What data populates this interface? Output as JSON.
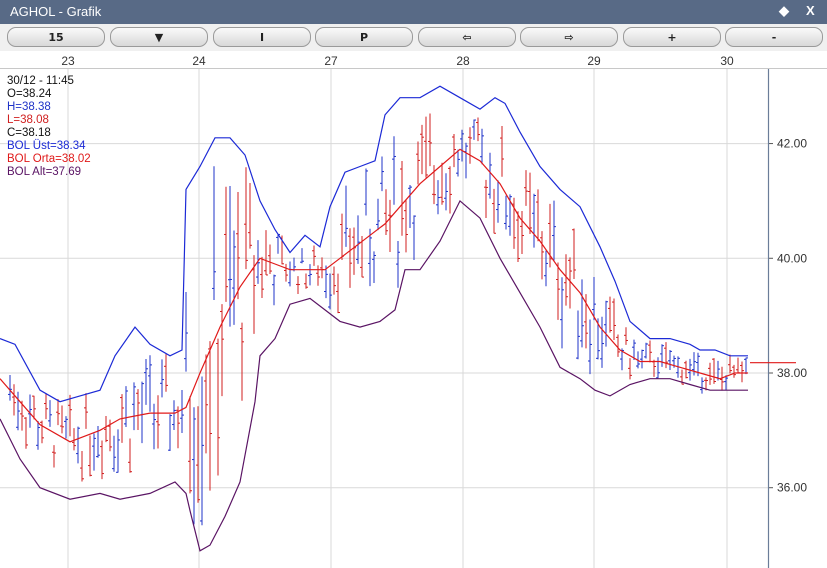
{
  "window": {
    "title": "AGHOL - Grafik",
    "pin_icon": "◆",
    "close_icon": "X"
  },
  "toolbar": {
    "buttons": [
      {
        "label": "15",
        "name": "interval-button"
      },
      {
        "label": "▼",
        "name": "chart-type-dropdown-button"
      },
      {
        "label": "I",
        "name": "indicator-button"
      },
      {
        "label": "P",
        "name": "period-button"
      },
      {
        "label": "⇦",
        "name": "scroll-left-button"
      },
      {
        "label": "⇨",
        "name": "scroll-right-button"
      },
      {
        "label": "+",
        "name": "zoom-in-button"
      },
      {
        "label": "-",
        "name": "zoom-out-button"
      }
    ]
  },
  "legend": {
    "datetime": "30/12 - 11:45",
    "open": "O=38.24",
    "high": "H=38.38",
    "low": "L=38.08",
    "close": "C=38.18",
    "bol_upper": "BOL Üst=38.34",
    "bol_middle": "BOL Orta=38.02",
    "bol_lower": "BOL Alt=37.69"
  },
  "colors": {
    "up_bar": "#1f33c8",
    "down_bar": "#d01f1f",
    "bol_upper": "#1c2ad6",
    "bol_middle": "#e01a1a",
    "bol_lower": "#5a1464",
    "grid": "#d9d9d9",
    "axis": "#6b7d99"
  },
  "chart_data": {
    "type": "ohlc",
    "x_labels": [
      "23",
      "24",
      "27",
      "28",
      "29",
      "30"
    ],
    "y_ticks": [
      "36.00",
      "38.00",
      "40.00",
      "42.00"
    ],
    "ylim": [
      34.6,
      43.3
    ],
    "last_price_marker": 38.18,
    "grid": true,
    "series": [
      {
        "name": "BOL Üst",
        "role": "bol_upper",
        "values": [
          [
            0,
            38.6
          ],
          [
            15,
            38.5
          ],
          [
            40,
            37.7
          ],
          [
            60,
            37.5
          ],
          [
            80,
            37.6
          ],
          [
            100,
            37.7
          ],
          [
            115,
            38.3
          ],
          [
            135,
            38.8
          ],
          [
            150,
            38.5
          ],
          [
            170,
            38.3
          ],
          [
            182,
            38.4
          ],
          [
            186,
            41.2
          ],
          [
            200,
            41.6
          ],
          [
            215,
            42.1
          ],
          [
            230,
            42.1
          ],
          [
            245,
            41.8
          ],
          [
            260,
            41.0
          ],
          [
            275,
            40.5
          ],
          [
            290,
            40.1
          ],
          [
            305,
            40.4
          ],
          [
            320,
            40.2
          ],
          [
            330,
            40.9
          ],
          [
            345,
            41.5
          ],
          [
            360,
            41.6
          ],
          [
            375,
            41.7
          ],
          [
            385,
            42.5
          ],
          [
            400,
            42.8
          ],
          [
            420,
            42.8
          ],
          [
            440,
            43.0
          ],
          [
            460,
            42.8
          ],
          [
            480,
            42.6
          ],
          [
            495,
            42.8
          ],
          [
            505,
            42.7
          ],
          [
            520,
            42.2
          ],
          [
            540,
            41.6
          ],
          [
            560,
            41.2
          ],
          [
            580,
            40.9
          ],
          [
            600,
            40.2
          ],
          [
            615,
            39.6
          ],
          [
            630,
            38.9
          ],
          [
            650,
            38.6
          ],
          [
            670,
            38.6
          ],
          [
            690,
            38.5
          ],
          [
            700,
            38.4
          ],
          [
            715,
            38.4
          ],
          [
            730,
            38.3
          ],
          [
            748,
            38.3
          ]
        ]
      },
      {
        "name": "BOL Orta",
        "role": "bol_middle",
        "values": [
          [
            0,
            37.9
          ],
          [
            20,
            37.5
          ],
          [
            40,
            37.1
          ],
          [
            70,
            36.8
          ],
          [
            100,
            37.0
          ],
          [
            120,
            37.2
          ],
          [
            150,
            37.3
          ],
          [
            175,
            37.3
          ],
          [
            186,
            37.4
          ],
          [
            200,
            38.0
          ],
          [
            220,
            38.8
          ],
          [
            240,
            39.5
          ],
          [
            260,
            40.0
          ],
          [
            275,
            39.9
          ],
          [
            290,
            39.8
          ],
          [
            310,
            39.8
          ],
          [
            325,
            39.8
          ],
          [
            340,
            40.0
          ],
          [
            355,
            40.2
          ],
          [
            370,
            40.4
          ],
          [
            385,
            40.6
          ],
          [
            400,
            40.9
          ],
          [
            420,
            41.3
          ],
          [
            440,
            41.6
          ],
          [
            460,
            41.9
          ],
          [
            480,
            41.7
          ],
          [
            500,
            41.3
          ],
          [
            520,
            40.7
          ],
          [
            540,
            40.3
          ],
          [
            560,
            39.8
          ],
          [
            580,
            39.4
          ],
          [
            600,
            38.8
          ],
          [
            620,
            38.4
          ],
          [
            640,
            38.2
          ],
          [
            660,
            38.2
          ],
          [
            680,
            38.1
          ],
          [
            700,
            38.0
          ],
          [
            720,
            37.9
          ],
          [
            735,
            38.0
          ],
          [
            748,
            38.0
          ]
        ]
      },
      {
        "name": "BOL Alt",
        "role": "bol_lower",
        "values": [
          [
            0,
            37.2
          ],
          [
            20,
            36.5
          ],
          [
            40,
            36.0
          ],
          [
            70,
            35.8
          ],
          [
            100,
            35.9
          ],
          [
            120,
            35.8
          ],
          [
            150,
            35.9
          ],
          [
            175,
            36.1
          ],
          [
            186,
            35.9
          ],
          [
            190,
            35.6
          ],
          [
            200,
            34.9
          ],
          [
            210,
            35.0
          ],
          [
            225,
            35.5
          ],
          [
            240,
            36.1
          ],
          [
            255,
            37.5
          ],
          [
            260,
            38.3
          ],
          [
            275,
            38.6
          ],
          [
            290,
            39.2
          ],
          [
            310,
            39.3
          ],
          [
            325,
            39.1
          ],
          [
            340,
            38.9
          ],
          [
            360,
            38.8
          ],
          [
            380,
            38.9
          ],
          [
            395,
            39.1
          ],
          [
            405,
            39.8
          ],
          [
            420,
            39.8
          ],
          [
            440,
            40.3
          ],
          [
            460,
            41.0
          ],
          [
            480,
            40.7
          ],
          [
            500,
            40.0
          ],
          [
            520,
            39.4
          ],
          [
            540,
            38.8
          ],
          [
            560,
            38.1
          ],
          [
            580,
            37.9
          ],
          [
            595,
            37.7
          ],
          [
            610,
            37.6
          ],
          [
            630,
            37.8
          ],
          [
            650,
            37.9
          ],
          [
            670,
            37.9
          ],
          [
            690,
            37.8
          ],
          [
            710,
            37.7
          ],
          [
            730,
            37.7
          ],
          [
            748,
            37.7
          ]
        ]
      }
    ]
  }
}
